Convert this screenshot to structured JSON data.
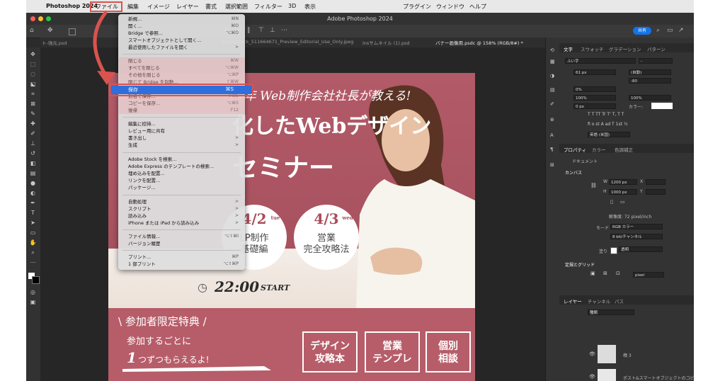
{
  "menubar": {
    "apple": "",
    "items": [
      "Photoshop 2024",
      "ファイル",
      "編集",
      "イメージ",
      "レイヤー",
      "書式",
      "選択範囲",
      "フィルター",
      "3D",
      "表示",
      "プラグイン",
      "ウィンドウ",
      "ヘルプ"
    ]
  },
  "window": {
    "title": "Adobe Photoshop 2024",
    "share_label": "共有"
  },
  "tabs": [
    "ト-強元.psd",
    "AdobeStock_511664671_Preview_Editorial_Use_Only.jpeg",
    "insサムネイル (1).psd",
    "バナー画像用.psdc @ 158% (RGB/8#) *"
  ],
  "file_menu": {
    "items": [
      {
        "label": "新規...",
        "shortcut": "⌘N"
      },
      {
        "label": "開く...",
        "shortcut": "⌘O"
      },
      {
        "label": "Bridge で参照...",
        "shortcut": "⌥⌘O"
      },
      {
        "label": "スマートオブジェクトとして開く...",
        "shortcut": ""
      },
      {
        "label": "最近使用したファイルを開く",
        "shortcut": ">"
      },
      {
        "label": "閉じる",
        "shortcut": "⌘W"
      },
      {
        "label": "すべてを閉じる",
        "shortcut": "⌥⌘W"
      },
      {
        "label": "その他を閉じる",
        "shortcut": "⌥⌘P"
      },
      {
        "label": "閉じて Bridge を起動...",
        "shortcut": "⇧⌘W"
      },
      {
        "label": "保存",
        "shortcut": "⌘S"
      },
      {
        "label": "別名で保存...",
        "shortcut": "⇧⌘S"
      },
      {
        "label": "コピーを保存...",
        "shortcut": "⌥⌘S"
      },
      {
        "label": "復帰",
        "shortcut": "F12"
      },
      {
        "label": "編集に招待...",
        "shortcut": ""
      },
      {
        "label": "レビュー用に共有",
        "shortcut": ""
      },
      {
        "label": "書き出し",
        "shortcut": ">"
      },
      {
        "label": "生成",
        "shortcut": ">"
      },
      {
        "label": "Adobe Stock を検索...",
        "shortcut": ""
      },
      {
        "label": "Adobe Express のテンプレートの検索...",
        "shortcut": ""
      },
      {
        "label": "埋め込みを配置...",
        "shortcut": ""
      },
      {
        "label": "リンクを配置...",
        "shortcut": ""
      },
      {
        "label": "パッケージ...",
        "shortcut": ""
      },
      {
        "label": "自動処理",
        "shortcut": ">"
      },
      {
        "label": "スクリプト",
        "shortcut": ">"
      },
      {
        "label": "読み込み",
        "shortcut": ">"
      },
      {
        "label": "iPhone または iPad から読み込み",
        "shortcut": ">"
      },
      {
        "label": "ファイル情報...",
        "shortcut": "⌥⇧⌘I"
      },
      {
        "label": "バージョン履歴",
        "shortcut": ""
      },
      {
        "label": "プリント...",
        "shortcut": "⌘P"
      },
      {
        "label": "1 部プリント",
        "shortcut": "⌥⇧⌘P"
      }
    ]
  },
  "artwork": {
    "headline1": "14年 Web制作会社社長が教える!",
    "headline2": "化したWebデザイン",
    "headline3": "セミナー",
    "date1": "4/2",
    "date1_day": "tue",
    "date1_line1": "LP制作",
    "date1_line2": "基礎編",
    "date2": "4/3",
    "date2_day": "wed",
    "date2_line1": "営業",
    "date2_line2": "完全攻略法",
    "time": "22:00",
    "start": "START",
    "benefit_title": "\\ 参加者限定特典 /",
    "benefit_line1": "参加するごとに",
    "benefit_line2_num": "1",
    "benefit_line2": "つずつもらえるよ!",
    "gifts": [
      {
        "line1": "デザイン",
        "line2": "攻略本"
      },
      {
        "line1": "営業",
        "line2": "テンプレ"
      },
      {
        "line1": "個別",
        "line2": "相談"
      }
    ]
  },
  "right_panel": {
    "tabs1": [
      "文字",
      "スウォッチ",
      "グラデーション",
      "パターン"
    ],
    "font_family": "ふい字",
    "font_style": "-",
    "font_size": "61 px",
    "leading": "(自動)",
    "tracking": "-80",
    "scale_pct": "0%",
    "vscale": "100%",
    "hscale": "100%",
    "baseline": "0 px",
    "color_label": "カラー:",
    "lang": "英語 (米国)",
    "tabs2": [
      "プロパティ",
      "カラー",
      "色調補正"
    ],
    "doc_label": "ドキュメント",
    "canvas_label": "カンバス",
    "w_label": "W",
    "w_value": "1200 px",
    "x_label": "X",
    "h_label": "H",
    "h_value": "1000 px",
    "y_label": "Y",
    "resolution": "解像度: 72 pixel/inch",
    "mode_label": "モード",
    "mode_value": "RGB カラー",
    "bits_value": "8 bit/チャンネル",
    "fill_label": "塗り",
    "fill_value": "透明",
    "rulers_label": "定規とグリッド",
    "grid_unit": "pixel",
    "tabs3": [
      "レイヤー",
      "チャンネル",
      "パス"
    ],
    "layer_search": "種類",
    "layer1": "楕 3",
    "layer2": "ポスト&スマートオブジェクトのコピー 2"
  }
}
